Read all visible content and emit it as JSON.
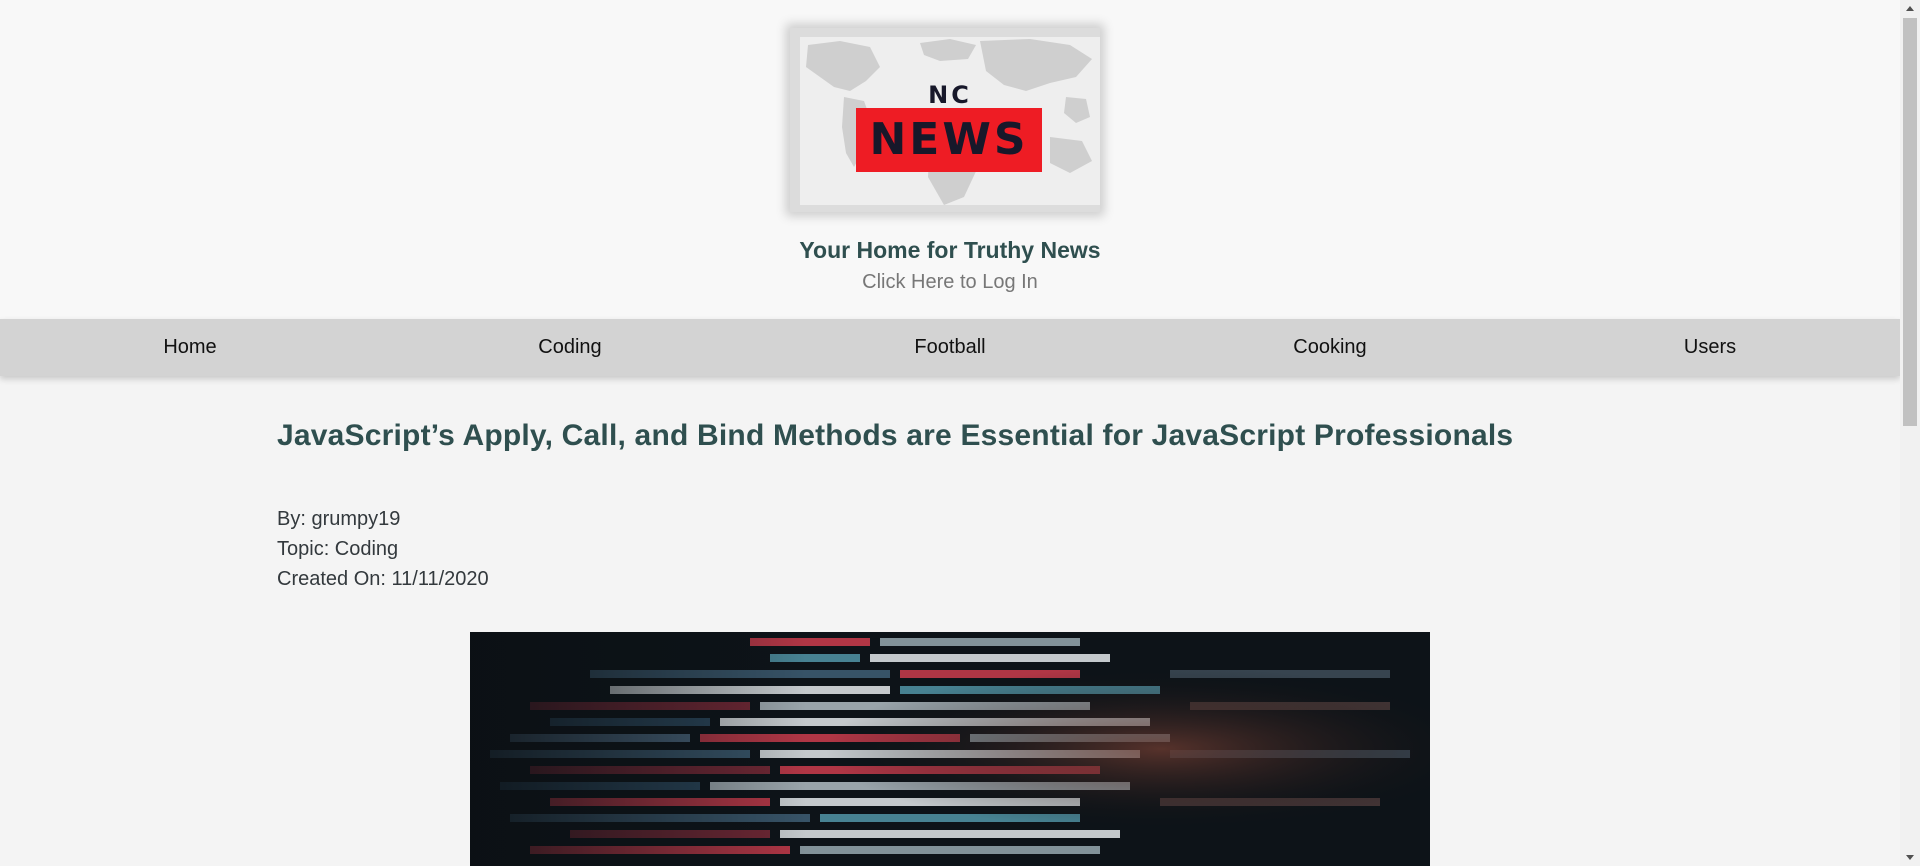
{
  "header": {
    "logo": {
      "nc": "NC",
      "news": "NEWS",
      "accent_color": "#ee1c24"
    },
    "tagline": "Your Home for Truthy News",
    "login_link": "Click Here to Log In"
  },
  "nav": {
    "items": [
      {
        "label": "Home"
      },
      {
        "label": "Coding"
      },
      {
        "label": "Football"
      },
      {
        "label": "Cooking"
      },
      {
        "label": "Users"
      }
    ]
  },
  "article": {
    "title": "JavaScript’s Apply, Call, and Bind Methods are Essential for JavaScript Professionals",
    "author": "By: grumpy19",
    "topic": "Topic: Coding",
    "created_on": "Created On: 11/11/2020",
    "image_icon": "code-screen-image"
  },
  "colors": {
    "title": "#2f4f4f",
    "nav_background": "#d3d3d3",
    "page_background": "#f4f4f4"
  }
}
